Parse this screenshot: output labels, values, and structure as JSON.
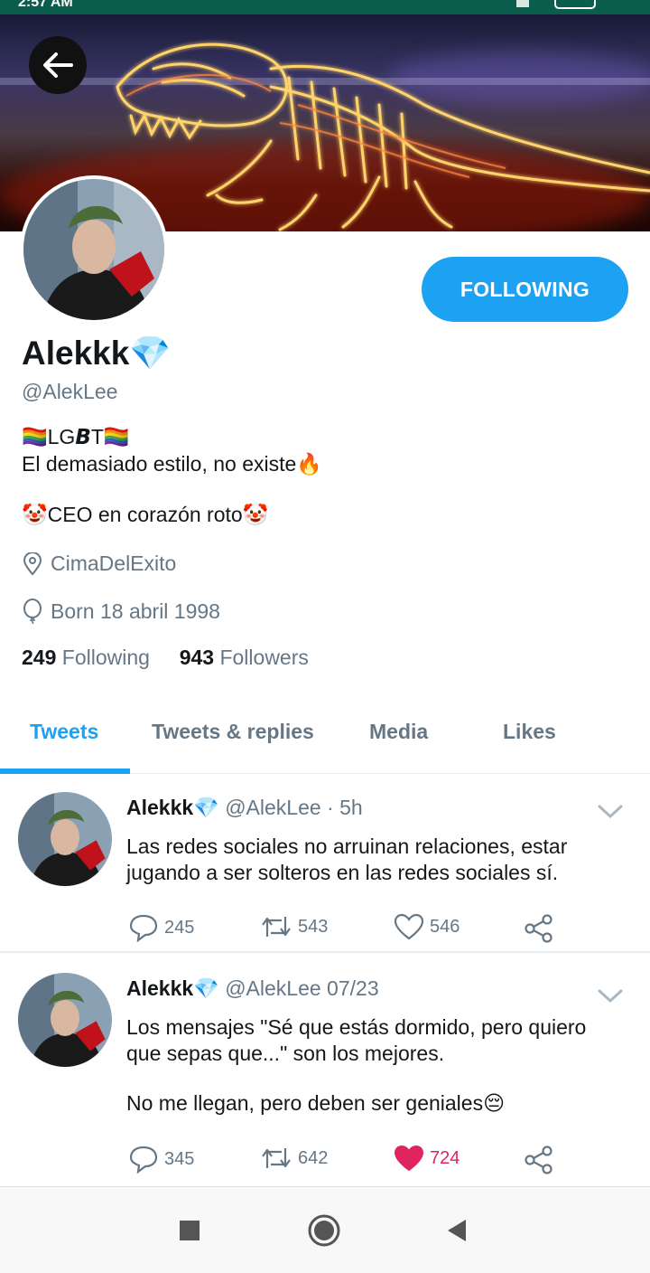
{
  "status_bar": {
    "time": "2:57 AM"
  },
  "profile": {
    "display_name": "Alekkk💎",
    "handle": "@AlekLee",
    "follow_button_label": "FOLLOWING",
    "bio_line1": "🏳️‍🌈LG𝘽T🏳️‍🌈",
    "bio_line2": "El demasiado estilo, no existe🔥",
    "bio_line3": "🤡CEO en corazón roto🤡",
    "location": "CimaDelExito",
    "birthday": "Born 18 abril 1998",
    "following_count": "249",
    "following_label": "Following",
    "followers_count": "943",
    "followers_label": "Followers"
  },
  "tabs": [
    {
      "label": "Tweets",
      "active": true
    },
    {
      "label": "Tweets & replies",
      "active": false
    },
    {
      "label": "Media",
      "active": false
    },
    {
      "label": "Likes",
      "active": false
    }
  ],
  "tweets": [
    {
      "author": "Alekkk💎",
      "meta": "@AlekLee · 5h",
      "text_line1": "Las redes sociales no arruinan relaciones, estar",
      "text_line2": "jugando a ser solteros en las redes sociales sí.",
      "replies": "245",
      "retweets": "543",
      "likes": "546",
      "liked": false
    },
    {
      "author": "Alekkk💎",
      "meta": "@AlekLee 07/23",
      "text_line1": "Los mensajes \"Sé que estás dormido, pero quiero",
      "text_line2": "que sepas que...\" son los mejores.",
      "text_line3": "No me llegan, pero deben ser geniales😔",
      "replies": "345",
      "retweets": "642",
      "likes": "724",
      "liked": true
    }
  ],
  "colors": {
    "accent": "#1da1f2",
    "like": "#e0245e",
    "secondary_text": "#657786",
    "primary_text": "#14171a",
    "status_bar": "#0b5e4d"
  },
  "icons": {
    "back": "arrow-left-icon",
    "location": "location-pin-icon",
    "birthday": "balloon-icon",
    "reply": "reply-icon",
    "retweet": "retweet-icon",
    "like": "heart-icon",
    "share": "share-icon",
    "menu": "chevron-down-icon",
    "nav_recent": "square-icon",
    "nav_home": "circle-icon",
    "nav_back": "triangle-back-icon"
  }
}
